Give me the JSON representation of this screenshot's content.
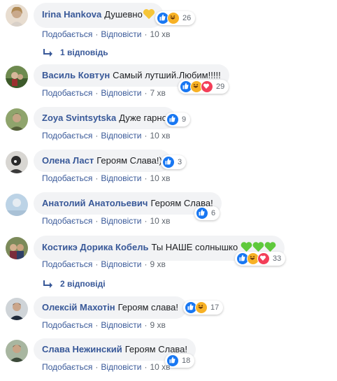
{
  "colors": {
    "link": "#385898",
    "meta": "#606770",
    "bubble": "#f2f3f5",
    "like": "#1877f2",
    "haha": "#f7b125",
    "love": "#f33e58"
  },
  "comments": [
    {
      "author": "Irina Hankova",
      "text": "Душевно",
      "inline_emoji": [
        "yellow-heart"
      ],
      "reactions": [
        "like",
        "haha"
      ],
      "count": "26",
      "like_label": "Подобається",
      "reply_label": "Відповісти",
      "time": "10 хв",
      "replies_label": "1 відповідь"
    },
    {
      "author": "Василь Ковтун",
      "text": "Самый лутший.Любим!!!!!",
      "inline_emoji": [],
      "reactions": [
        "like",
        "haha",
        "love"
      ],
      "count": "29",
      "like_label": "Подобається",
      "reply_label": "Відповісти",
      "time": "7 хв"
    },
    {
      "author": "Zoya Svintsytska",
      "text": "Дуже гарно",
      "inline_emoji": [],
      "reactions": [
        "like"
      ],
      "count": "9",
      "like_label": "Подобається",
      "reply_label": "Відповісти",
      "time": "10 хв"
    },
    {
      "author": "Олена Ласт",
      "text": "Героям Слава!)",
      "inline_emoji": [],
      "reactions": [
        "like"
      ],
      "count": "3",
      "like_label": "Подобається",
      "reply_label": "Відповісти",
      "time": "10 хв"
    },
    {
      "author": "Анатолий Анатольевич",
      "text": "Героям Слава!",
      "inline_emoji": [],
      "reactions": [
        "like"
      ],
      "count": "6",
      "like_label": "Подобається",
      "reply_label": "Відповісти",
      "time": "10 хв"
    },
    {
      "author": "Костикэ Дорика Кобель",
      "text": "Ты НАШЕ солнышко",
      "inline_emoji": [
        "green-heart",
        "green-heart",
        "green-heart"
      ],
      "reactions": [
        "like",
        "haha",
        "love"
      ],
      "count": "33",
      "like_label": "Подобається",
      "reply_label": "Відповісти",
      "time": "9 хв",
      "replies_label": "2 відповіді"
    },
    {
      "author": "Олексій Махотін",
      "text": "Героям слава!",
      "inline_emoji": [],
      "reactions": [
        "like",
        "haha"
      ],
      "count": "17",
      "like_label": "Подобається",
      "reply_label": "Відповісти",
      "time": "9 хв"
    },
    {
      "author": "Слава Нежинский",
      "text": "Героям Слава!",
      "inline_emoji": [],
      "reactions": [
        "like"
      ],
      "count": "18",
      "like_label": "Подобається",
      "reply_label": "Відповісти",
      "time": "10 хв"
    }
  ]
}
